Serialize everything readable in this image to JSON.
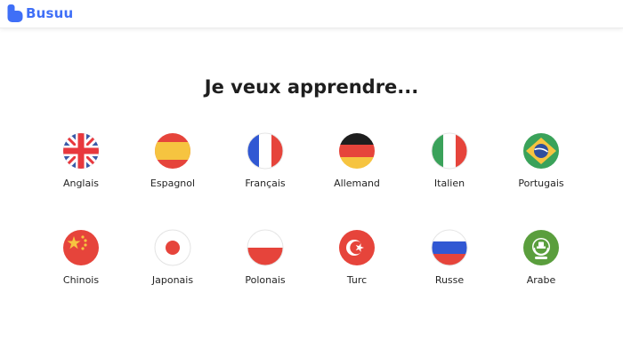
{
  "brand": {
    "name": "Busuu",
    "color": "#3f6ff7"
  },
  "heading": "Je veux apprendre...",
  "languages": [
    {
      "label": "Anglais",
      "icon": "uk-flag-icon"
    },
    {
      "label": "Espagnol",
      "icon": "spain-flag-icon"
    },
    {
      "label": "Français",
      "icon": "france-flag-icon"
    },
    {
      "label": "Allemand",
      "icon": "germany-flag-icon"
    },
    {
      "label": "Italien",
      "icon": "italy-flag-icon"
    },
    {
      "label": "Portugais",
      "icon": "brazil-flag-icon"
    },
    {
      "label": "Chinois",
      "icon": "china-flag-icon"
    },
    {
      "label": "Japonais",
      "icon": "japan-flag-icon"
    },
    {
      "label": "Polonais",
      "icon": "poland-flag-icon"
    },
    {
      "label": "Turc",
      "icon": "turkey-flag-icon"
    },
    {
      "label": "Russe",
      "icon": "russia-flag-icon"
    },
    {
      "label": "Arabe",
      "icon": "arabic-league-flag-icon"
    }
  ]
}
